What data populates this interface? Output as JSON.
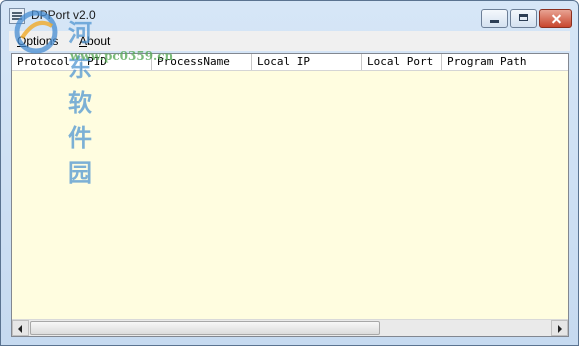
{
  "window": {
    "title": "DPPort  v2.0"
  },
  "menu": {
    "options_first": "O",
    "options_rest": "ptions",
    "about_first": "A",
    "about_rest": "bout"
  },
  "table": {
    "columns": [
      "Protocol",
      "PID",
      "ProcessName",
      "Local IP",
      "Local Port",
      "Program Path"
    ],
    "rows": []
  },
  "watermark": {
    "site_name": "河东软件园",
    "url": "www.pc0359.cn"
  },
  "colors": {
    "list_background": "#fffde0",
    "title_bar": "#c6daf0",
    "close_button": "#c8462d"
  }
}
